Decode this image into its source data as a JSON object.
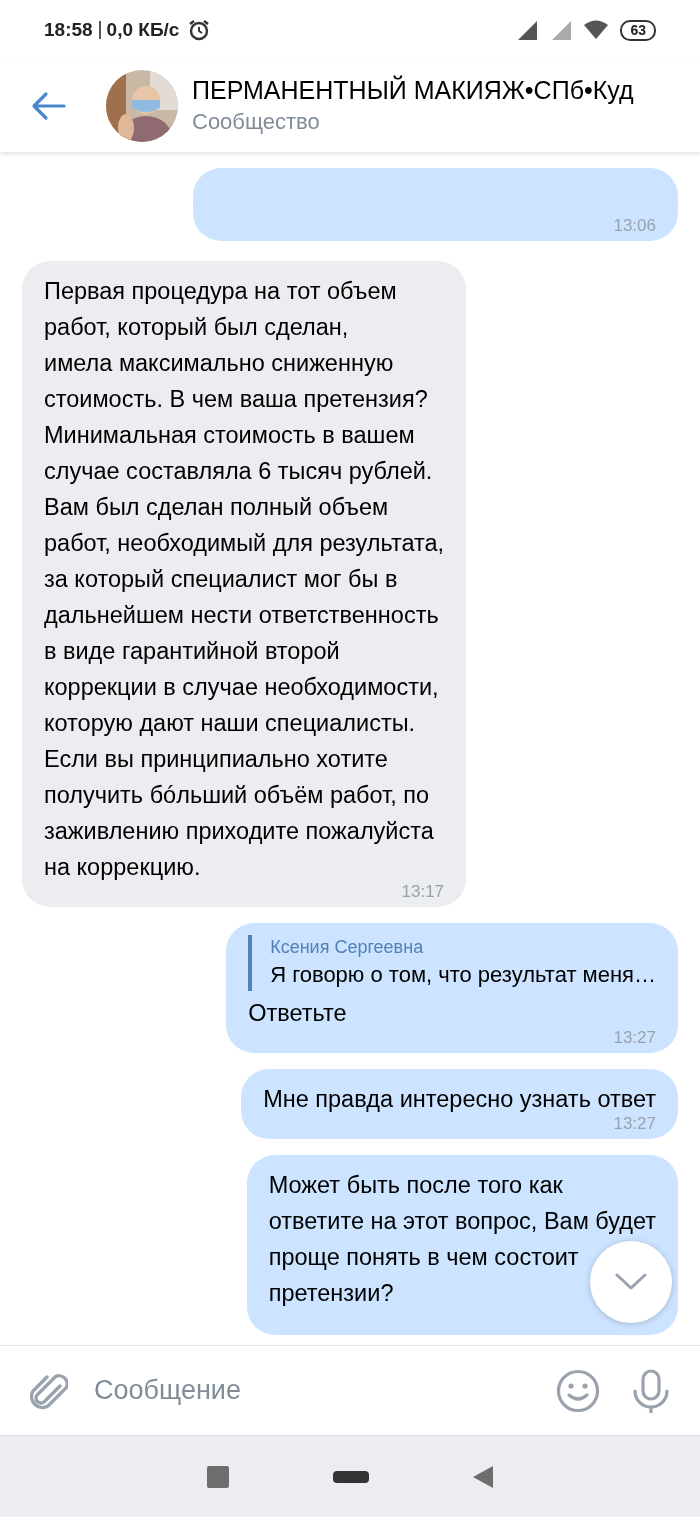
{
  "status_bar": {
    "time": "18:58",
    "network_speed": "0,0 КБ/с",
    "battery": "63"
  },
  "header": {
    "title": "ПЕРМАНЕНТНЫЙ МАКИЯЖ•СПб•Куд",
    "subtitle": "Сообщество"
  },
  "messages": [
    {
      "kind": "outgoing",
      "time": "13:06"
    },
    {
      "kind": "incoming",
      "text": "Первая процедура на тот объем\nработ, который был сделан,\nимела максимально сниженную\nстоимость. В чем ваша претензия?\nМинимальная стоимость в вашем\nслучае составляла 6 тысяч рублей.\nВам был сделан полный объем\nработ, необходимый для результата,\nза который специалист мог бы в\nдальнейшем нести ответственность\nв виде гарантийной второй\nкоррекции в случае необходимости,\nкоторую дают наши специалисты.\nЕсли вы принципиально хотите\nполучить бóльший объём работ, по\nзаживлению приходите пожалуйста\nна коррекцию.",
      "time": "13:17"
    },
    {
      "kind": "outgoing",
      "reply": {
        "author": "Ксения Сергеевна",
        "text": "Я говорю о том, что результат меня…"
      },
      "text": "Ответьте",
      "time": "13:27"
    },
    {
      "kind": "outgoing",
      "text": "Мне правда интересно узнать ответ",
      "time": "13:27"
    },
    {
      "kind": "outgoing",
      "text": "Может быть после того как\nответите на этот вопрос, Вам будет\nпроще понять в чем состоит\nпретензии?"
    }
  ],
  "composer": {
    "placeholder": "Сообщение"
  }
}
